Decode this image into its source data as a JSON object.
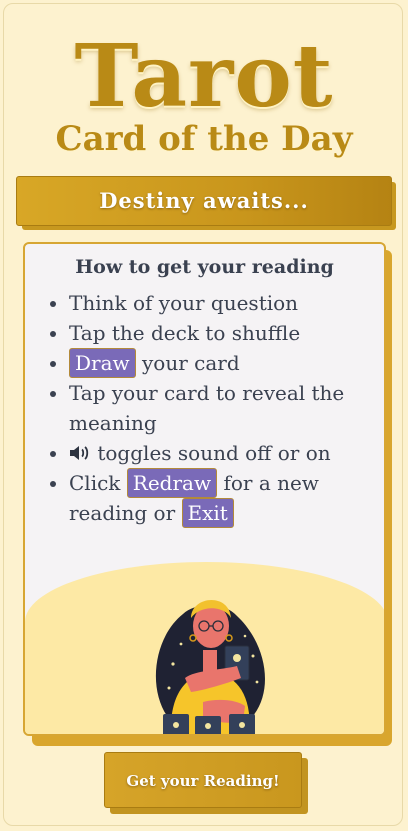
{
  "header": {
    "title": "Tarot",
    "subtitle": "Card of the Day"
  },
  "banner": {
    "text": "Destiny awaits..."
  },
  "instructions": {
    "heading": "How to get your reading",
    "item1": "Think of your question",
    "item2": "Tap the deck to shuffle",
    "item3_button": "Draw",
    "item3_rest": " your card",
    "item4": "Tap your card to reveal the meaning",
    "item5_icon": "speaker-icon",
    "item5_rest": " toggles sound off or on",
    "item6_pre": "Click ",
    "item6_button1": "Redraw",
    "item6_mid": " for a new reading or ",
    "item6_button2": "Exit"
  },
  "illustration": {
    "icon": "fortune-teller-illustration"
  },
  "cta": {
    "label": "Get your Reading!"
  },
  "colors": {
    "gold": "#c9961c",
    "button_purple": "#7a6ab8",
    "background": "#fdf2cf",
    "card_bg": "#f5f3f5"
  }
}
